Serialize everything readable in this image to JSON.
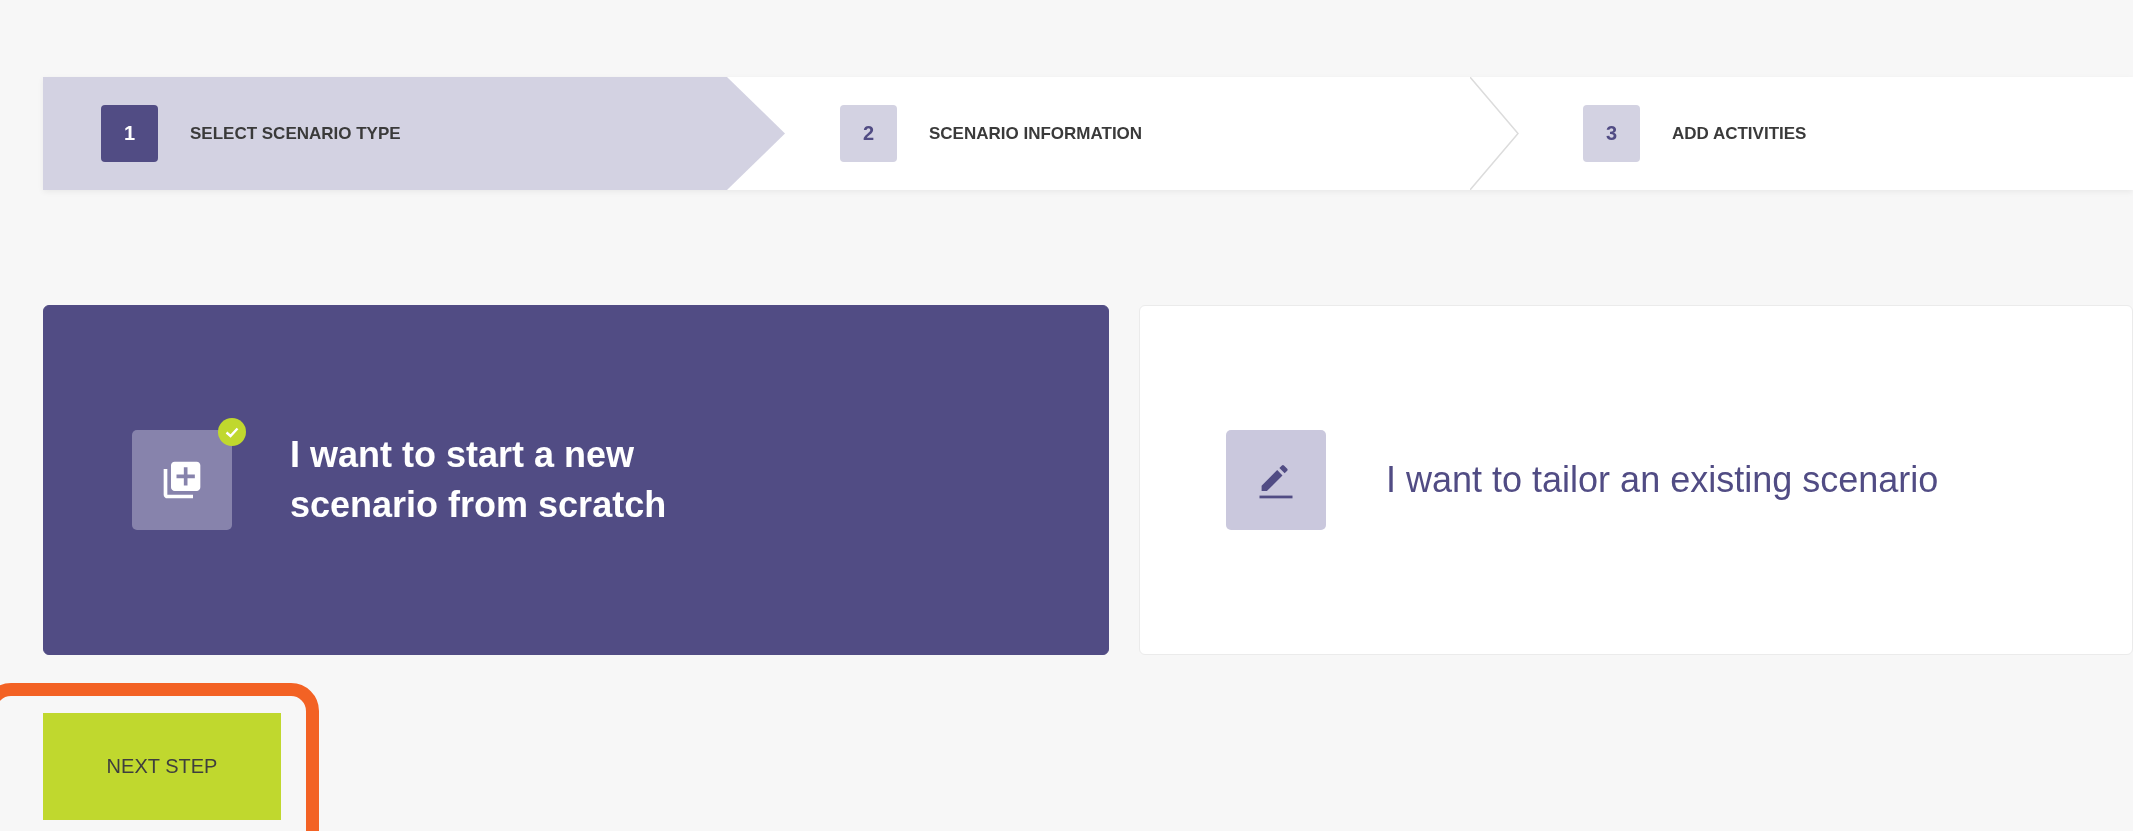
{
  "steps": [
    {
      "number": "1",
      "label": "SELECT SCENARIO TYPE",
      "selected": true
    },
    {
      "number": "2",
      "label": "SCENARIO INFORMATION",
      "selected": false
    },
    {
      "number": "3",
      "label": "ADD ACTIVITIES",
      "selected": false
    }
  ],
  "options": [
    {
      "kind": "new",
      "label": "I want to start a new scenario from scratch",
      "selected": true
    },
    {
      "kind": "tailor",
      "label": "I want to tailor an existing scenario",
      "selected": false
    }
  ],
  "next_button": {
    "label": "NEXT STEP",
    "highlighted": true
  }
}
